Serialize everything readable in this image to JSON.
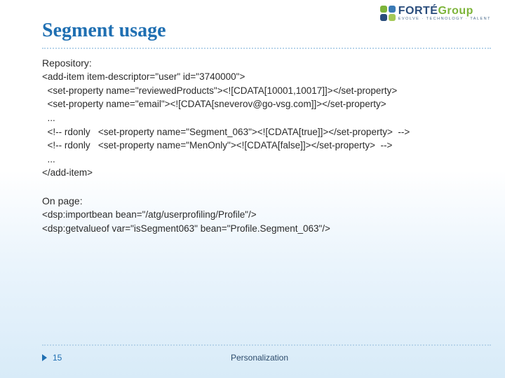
{
  "title": "Segment usage",
  "logo": {
    "main_a": "FORTÉ",
    "main_b": "Group",
    "subtitle": "EVOLVE · TECHNOLOGY · TALENT"
  },
  "content": {
    "heading1": "Repository:",
    "code1": "<add-item item-descriptor=\"user\" id=\"3740000\">\n  <set-property name=\"reviewedProducts\"><![CDATA[10001,10017]]></set-property>\n  <set-property name=\"email\"><![CDATA[sneverov@go-vsg.com]]></set-property>\n  ...\n  <!-- rdonly   <set-property name=\"Segment_063\"><![CDATA[true]]></set-property>  -->\n  <!-- rdonly   <set-property name=\"MenOnly\"><![CDATA[false]]></set-property>  -->\n  ...\n</add-item>",
    "heading2": "On page:",
    "code2": "<dsp:importbean bean=\"/atg/userprofiling/Profile\"/>\n<dsp:getvalueof var=\"isSegment063\" bean=\"Profile.Segment_063\"/>"
  },
  "footer": {
    "page_number": "15",
    "section": "Personalization"
  }
}
